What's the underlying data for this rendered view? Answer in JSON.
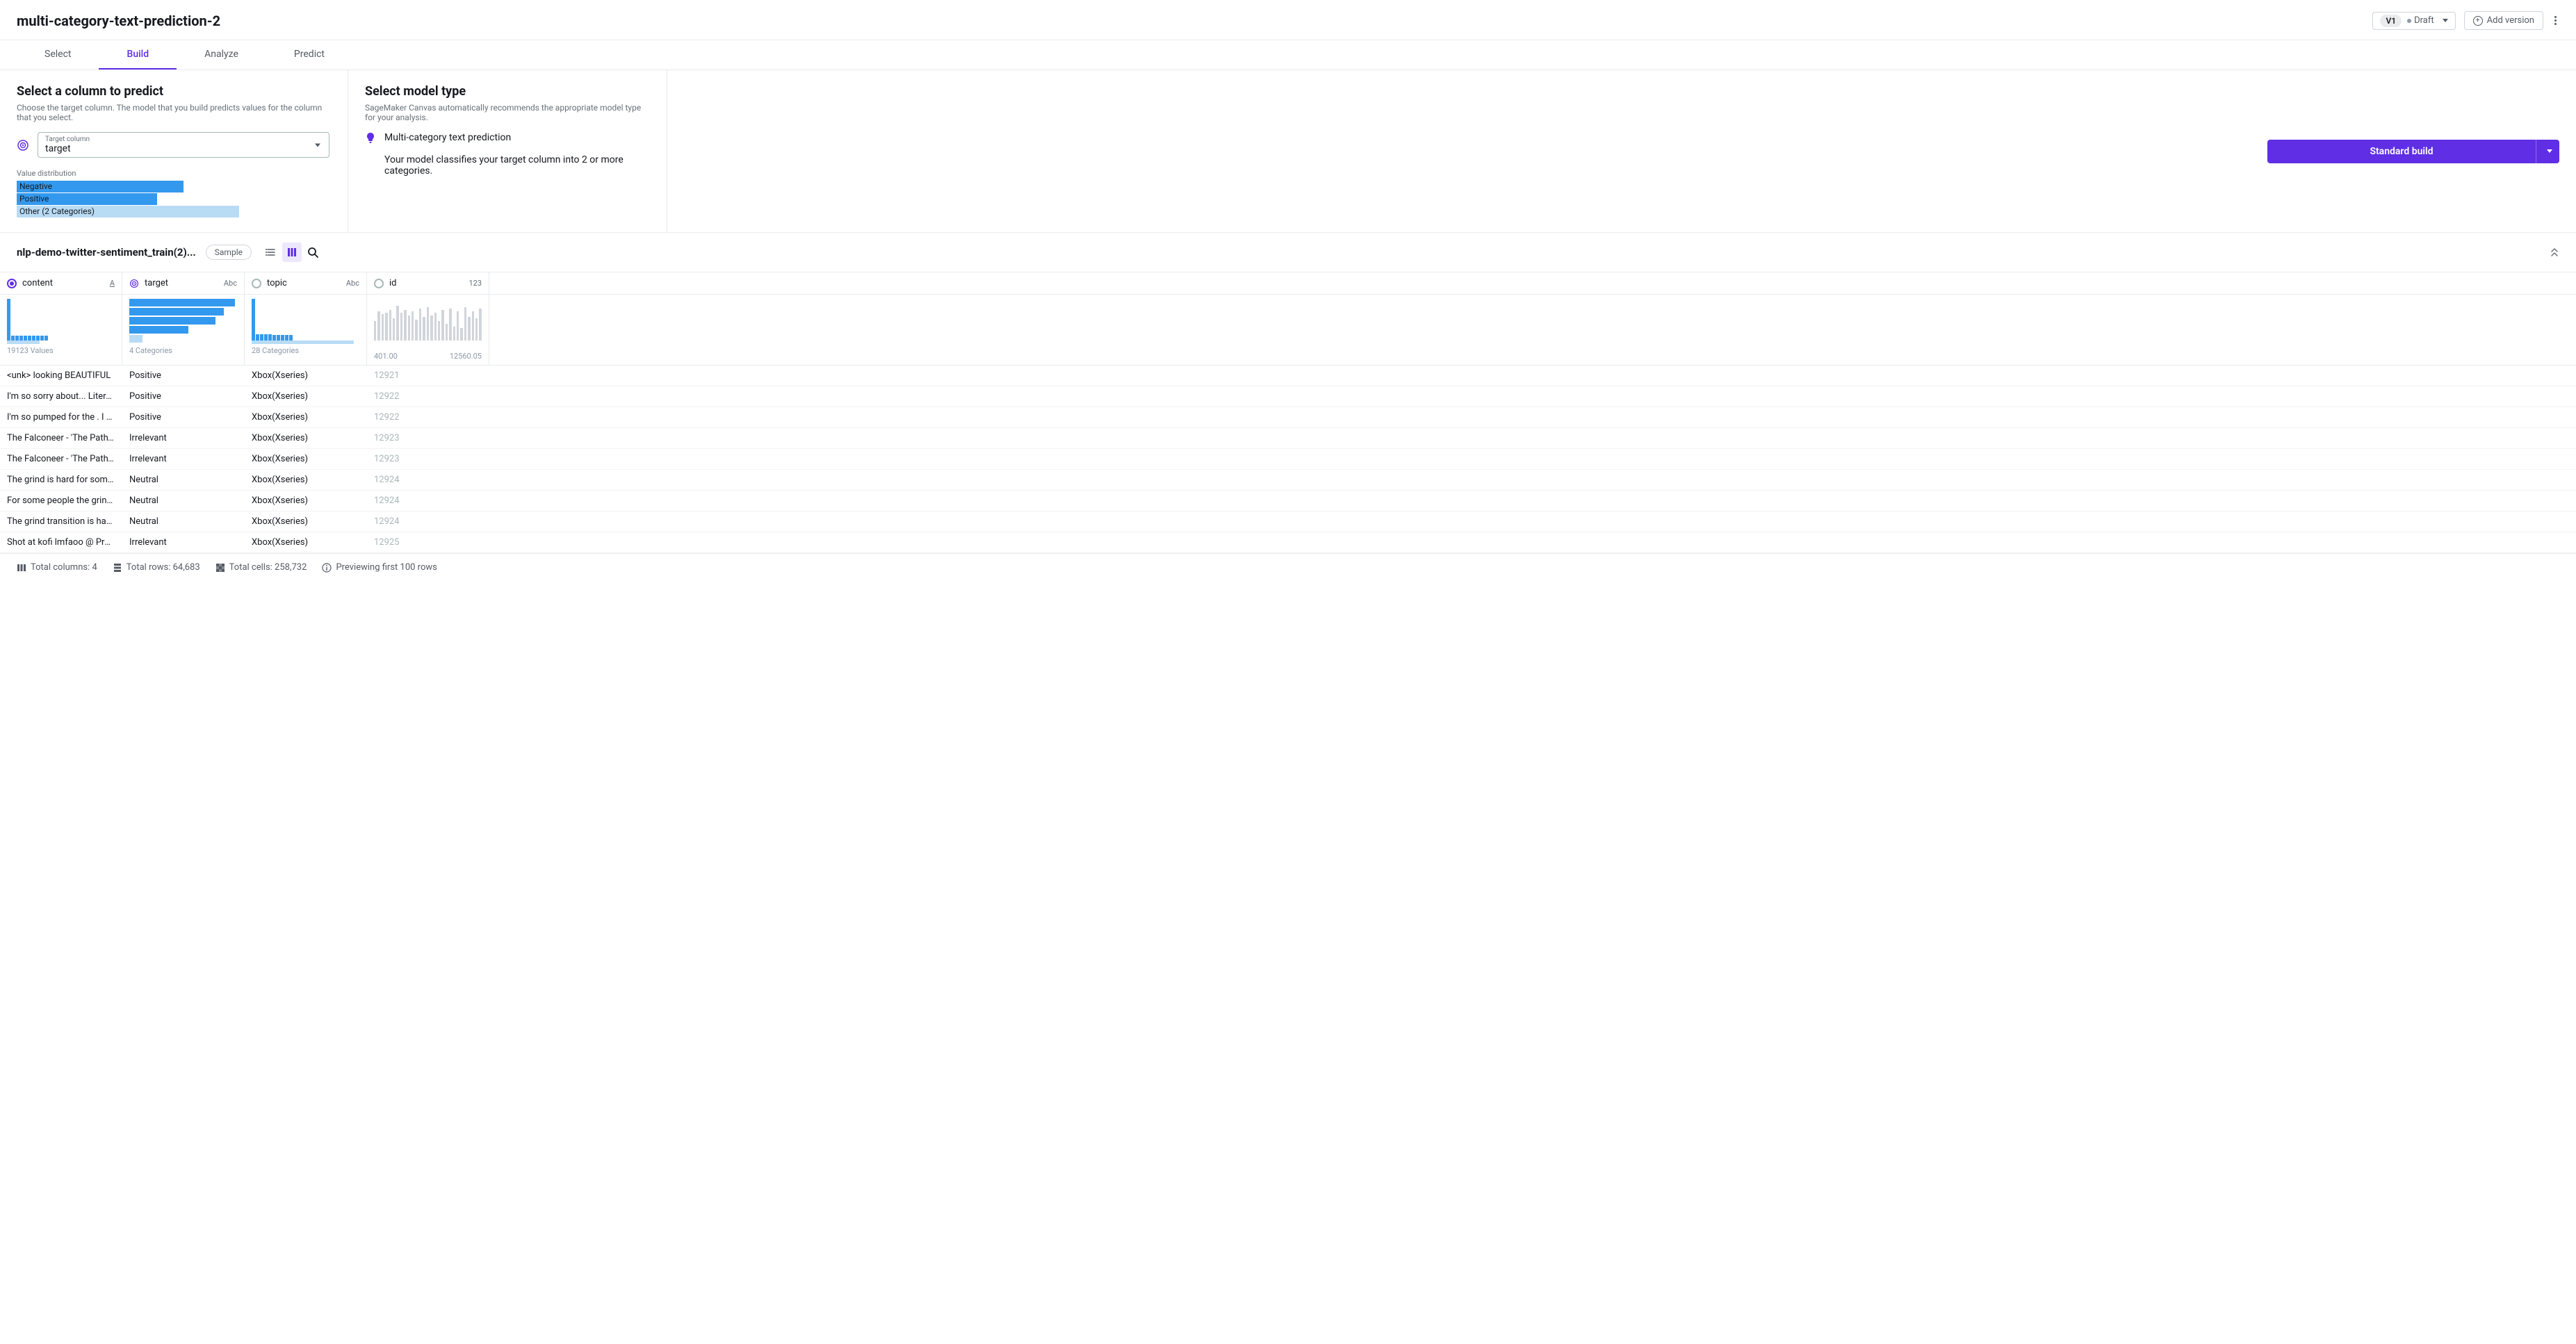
{
  "header": {
    "title": "multi-category-text-prediction-2",
    "version_badge": "V1",
    "status": "Draft",
    "add_version": "Add version"
  },
  "tabs": [
    "Select",
    "Build",
    "Analyze",
    "Predict"
  ],
  "active_tab": "Build",
  "predict_panel": {
    "title": "Select a column to predict",
    "desc": "Choose the target column. The model that you build predicts values for the column that you select.",
    "target_label": "Target column",
    "target_value": "target",
    "dist_label": "Value distribution",
    "dist": [
      {
        "label": "Negative",
        "width": 75,
        "light": false
      },
      {
        "label": "Positive",
        "width": 63,
        "light": false
      },
      {
        "label": "Other (2 Categories)",
        "width": 100,
        "light": true
      }
    ]
  },
  "model_panel": {
    "title": "Select model type",
    "desc": "SageMaker Canvas automatically recommends the appropriate model type for your analysis.",
    "type_name": "Multi-category text prediction",
    "type_desc": "Your model classifies your target column into 2 or more categories."
  },
  "build_button": "Standard build",
  "dataset": {
    "name": "nlp-demo-twitter-sentiment_train(2)...",
    "sample": "Sample"
  },
  "columns": [
    {
      "name": "content",
      "type": "A",
      "selected": true,
      "summary_left": "19123 Values",
      "summary_right": ""
    },
    {
      "name": "target",
      "type": "Abc",
      "selected": true,
      "is_target": true,
      "summary_left": "4 Categories",
      "summary_right": ""
    },
    {
      "name": "topic",
      "type": "Abc",
      "selected": false,
      "summary_left": "28 Categories",
      "summary_right": ""
    },
    {
      "name": "id",
      "type": "123",
      "selected": false,
      "summary_left": "401.00",
      "summary_right": "12560.05"
    }
  ],
  "chart_data": [
    {
      "type": "bar",
      "orientation": "vertical",
      "note": "content distinct values thumbnail",
      "values": [
        60,
        7,
        7,
        7,
        7,
        7,
        7,
        7,
        7,
        7
      ],
      "light_last": true,
      "light_last_value": 5
    },
    {
      "type": "bar",
      "orientation": "horizontal",
      "note": "target categories",
      "values": [
        98,
        88,
        80,
        55
      ],
      "light_last": true,
      "light_last_value": 12
    },
    {
      "type": "bar",
      "orientation": "vertical",
      "note": "topic categories",
      "values": [
        60,
        9,
        9,
        9,
        9,
        8,
        8,
        8,
        8,
        8
      ],
      "light_last": true,
      "light_last_wide": 95
    },
    {
      "type": "histogram",
      "note": "id numeric distribution",
      "values": [
        28,
        42,
        38,
        40,
        44,
        32,
        50,
        40,
        44,
        36,
        42,
        30,
        46,
        34,
        48,
        36,
        40,
        28,
        44,
        24,
        46,
        20,
        42,
        18,
        48,
        34,
        42,
        32,
        46
      ]
    }
  ],
  "rows": [
    {
      "content": "<unk> looking BEAUTIFUL",
      "target": "Positive",
      "topic": "Xbox(Xseries)",
      "id": "12921"
    },
    {
      "content": "I'm so sorry about... Literally can...",
      "target": "Positive",
      "topic": "Xbox(Xseries)",
      "id": "12922"
    },
    {
      "content": "I'm so pumped for the . I Literall...",
      "target": "Positive",
      "topic": "Xbox(Xseries)",
      "id": "12922"
    },
    {
      "content": "The Falconeer - 'The Path' Game...",
      "target": "Irrelevant",
      "topic": "Xbox(Xseries)",
      "id": "12923"
    },
    {
      "content": "The Falconeer - 'The Path' Game...",
      "target": "Irrelevant",
      "topic": "Xbox(Xseries)",
      "id": "12923"
    },
    {
      "content": "The grind is hard for some folks ...",
      "target": "Neutral",
      "topic": "Xbox(Xseries)",
      "id": "12924"
    },
    {
      "content": "For some people the grind is eve...",
      "target": "Neutral",
      "topic": "Xbox(Xseries)",
      "id": "12924"
    },
    {
      "content": "The grind transition is hard for s...",
      "target": "Neutral",
      "topic": "Xbox(Xseries)",
      "id": "12924"
    },
    {
      "content": "Shot at kofi lmfaoo @ PressStar...",
      "target": "Irrelevant",
      "topic": "Xbox(Xseries)",
      "id": "12925"
    }
  ],
  "footer": {
    "cols": "Total columns: 4",
    "rows": "Total rows: 64,683",
    "cells": "Total cells: 258,732",
    "preview": "Previewing first 100 rows"
  }
}
